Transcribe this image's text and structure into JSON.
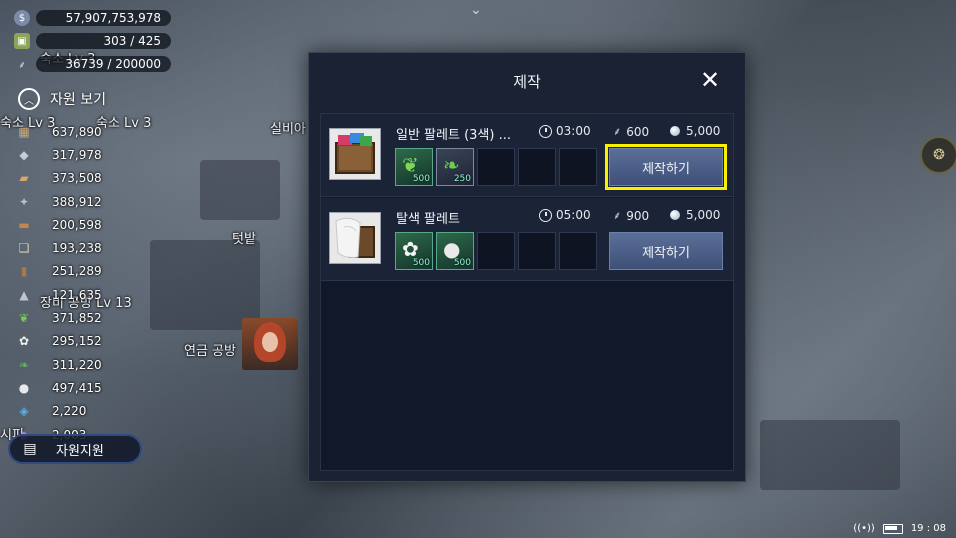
{
  "top_resources": [
    {
      "icon": "silver-coin-icon",
      "value": "57,907,753,978"
    },
    {
      "icon": "population-icon",
      "value": "303 / 425"
    },
    {
      "icon": "wheat-icon",
      "value": "36739 / 200000"
    }
  ],
  "resource_toggle_label": "자원 보기",
  "resources": [
    {
      "icon": "wood-log-icon",
      "value": "637,890"
    },
    {
      "icon": "stone-icon",
      "value": "317,978"
    },
    {
      "icon": "plank-icon",
      "value": "373,508"
    },
    {
      "icon": "iron-ore-icon",
      "value": "388,912"
    },
    {
      "icon": "timber-icon",
      "value": "200,598"
    },
    {
      "icon": "scroll-icon",
      "value": "193,238"
    },
    {
      "icon": "leather-icon",
      "value": "251,289"
    },
    {
      "icon": "ingot-icon",
      "value": "121,635"
    },
    {
      "icon": "herb-leaf-icon",
      "value": "371,852"
    },
    {
      "icon": "cotton-icon",
      "value": "295,152"
    },
    {
      "icon": "green-plant-icon",
      "value": "311,220"
    },
    {
      "icon": "wool-icon",
      "value": "497,415"
    },
    {
      "icon": "blue-crystal-icon",
      "value": "2,220"
    },
    {
      "icon": "purple-gem-icon",
      "value": "2,003"
    }
  ],
  "support_button_label": "자원지원",
  "background_labels": {
    "dorm1": "숙소 Lv 3",
    "dorm2": "숙소 Lv 3",
    "dorm3": "숙소 Lv 3",
    "silver": "실비아",
    "field": "텃밭",
    "equip": "장비 공방 Lv 13",
    "alchemy": "연금 공방",
    "shop": "시피"
  },
  "modal": {
    "title": "제작",
    "recipes": [
      {
        "name": "일반 팔레트 (3색) ...",
        "thumb_icon": "tricolor-palette-chest-icon",
        "time": "03:00",
        "wheat_cost": "600",
        "silver_cost": "5,000",
        "materials": [
          {
            "icon": "green-herb-icon",
            "qty": "500"
          },
          {
            "icon": "green-leaf-icon",
            "qty": "250"
          }
        ],
        "button_label": "제작하기",
        "highlighted": true
      },
      {
        "name": "탈색 팔레트",
        "thumb_icon": "bleach-palette-chest-icon",
        "time": "05:00",
        "wheat_cost": "900",
        "silver_cost": "5,000",
        "materials": [
          {
            "icon": "cotton-icon",
            "qty": "500"
          },
          {
            "icon": "wool-icon",
            "qty": "500"
          }
        ],
        "button_label": "제작하기",
        "highlighted": false
      }
    ]
  },
  "status_bar": {
    "time": "19 : 08"
  },
  "colors": {
    "highlight": "#f8f000",
    "button": "#4a5c84",
    "modal_bg": "#1a2234"
  }
}
